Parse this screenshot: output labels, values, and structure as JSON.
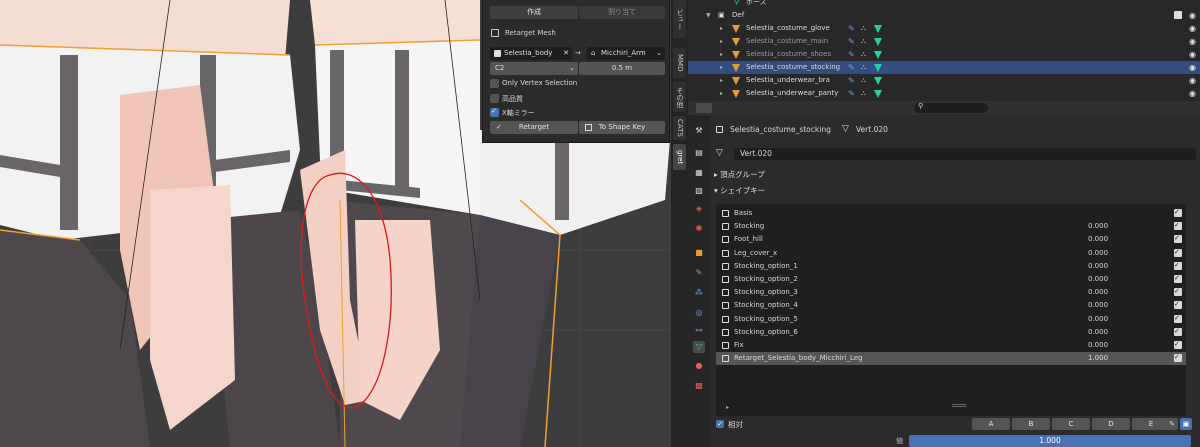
{
  "panel": {
    "tab_create": "作成",
    "tab_assign": "割り当て",
    "title": "Retarget Mesh",
    "source_mesh": "Selestia_body",
    "arrow": "→",
    "target_armature": "Micchiri_Arm",
    "mode_value": "C2",
    "distance_value": "0.5 m",
    "opt_vertex": "Only Vertex Selection",
    "opt_quality": "高品質",
    "opt_mirror": "X軸ミラー",
    "btn_retarget": "Retarget",
    "btn_shapekey": "To Shape Key"
  },
  "vtabs": [
    "ビュー",
    "MMD",
    "その他",
    "CATS",
    "gret"
  ],
  "outliner": {
    "pose_label": "ポーズ",
    "collection": "Def",
    "items": [
      {
        "name": "Selestia_costume_glove",
        "dim": false,
        "selected": false
      },
      {
        "name": "Selestia_costume_main",
        "dim": true,
        "selected": false
      },
      {
        "name": "Selestia_costume_shoes",
        "dim": true,
        "selected": false
      },
      {
        "name": "Selestia_costume_stocking",
        "dim": false,
        "selected": true
      },
      {
        "name": "Selestia_underwear_bra",
        "dim": false,
        "selected": false
      },
      {
        "name": "Selestia_underwear_panty",
        "dim": false,
        "selected": false
      }
    ]
  },
  "props": {
    "search_placeholder": "",
    "object_name": "Selestia_costume_stocking",
    "mesh_name": "Vert.020",
    "data_name": "Vert.020",
    "vertex_groups": "頂点グループ",
    "shape_keys": "シェイプキー",
    "keys": [
      {
        "name": "Basis",
        "value": "",
        "selected": false
      },
      {
        "name": "Stocking",
        "value": "0.000",
        "selected": false
      },
      {
        "name": "Foot_hill",
        "value": "0.000",
        "selected": false
      },
      {
        "name": "Leg_cover_x",
        "value": "0.000",
        "selected": false
      },
      {
        "name": "Stocking_option_1",
        "value": "0.000",
        "selected": false
      },
      {
        "name": "Stocking_option_2",
        "value": "0.000",
        "selected": false
      },
      {
        "name": "Stocking_option_3",
        "value": "0.000",
        "selected": false
      },
      {
        "name": "Stocking_option_4",
        "value": "0.000",
        "selected": false
      },
      {
        "name": "Stocking_option_5",
        "value": "0.000",
        "selected": false
      },
      {
        "name": "Stocking_option_6",
        "value": "0.000",
        "selected": false
      },
      {
        "name": "Fix",
        "value": "0.000",
        "selected": false
      },
      {
        "name": "Retarget_Selestia_body_Micchiri_Leg",
        "value": "1.000",
        "selected": true
      }
    ],
    "relative_label": "相対",
    "letters": [
      "A",
      "B",
      "C",
      "D",
      "E"
    ],
    "value_label": "値",
    "value": "1.000",
    "value_fraction": 1.0
  },
  "colors": {
    "accent": "#4772b3",
    "mesh_orange": "#e59b3c",
    "data_green": "#27d0a0",
    "selection_outline": "#f0a030",
    "annotation_red": "#e01818"
  }
}
